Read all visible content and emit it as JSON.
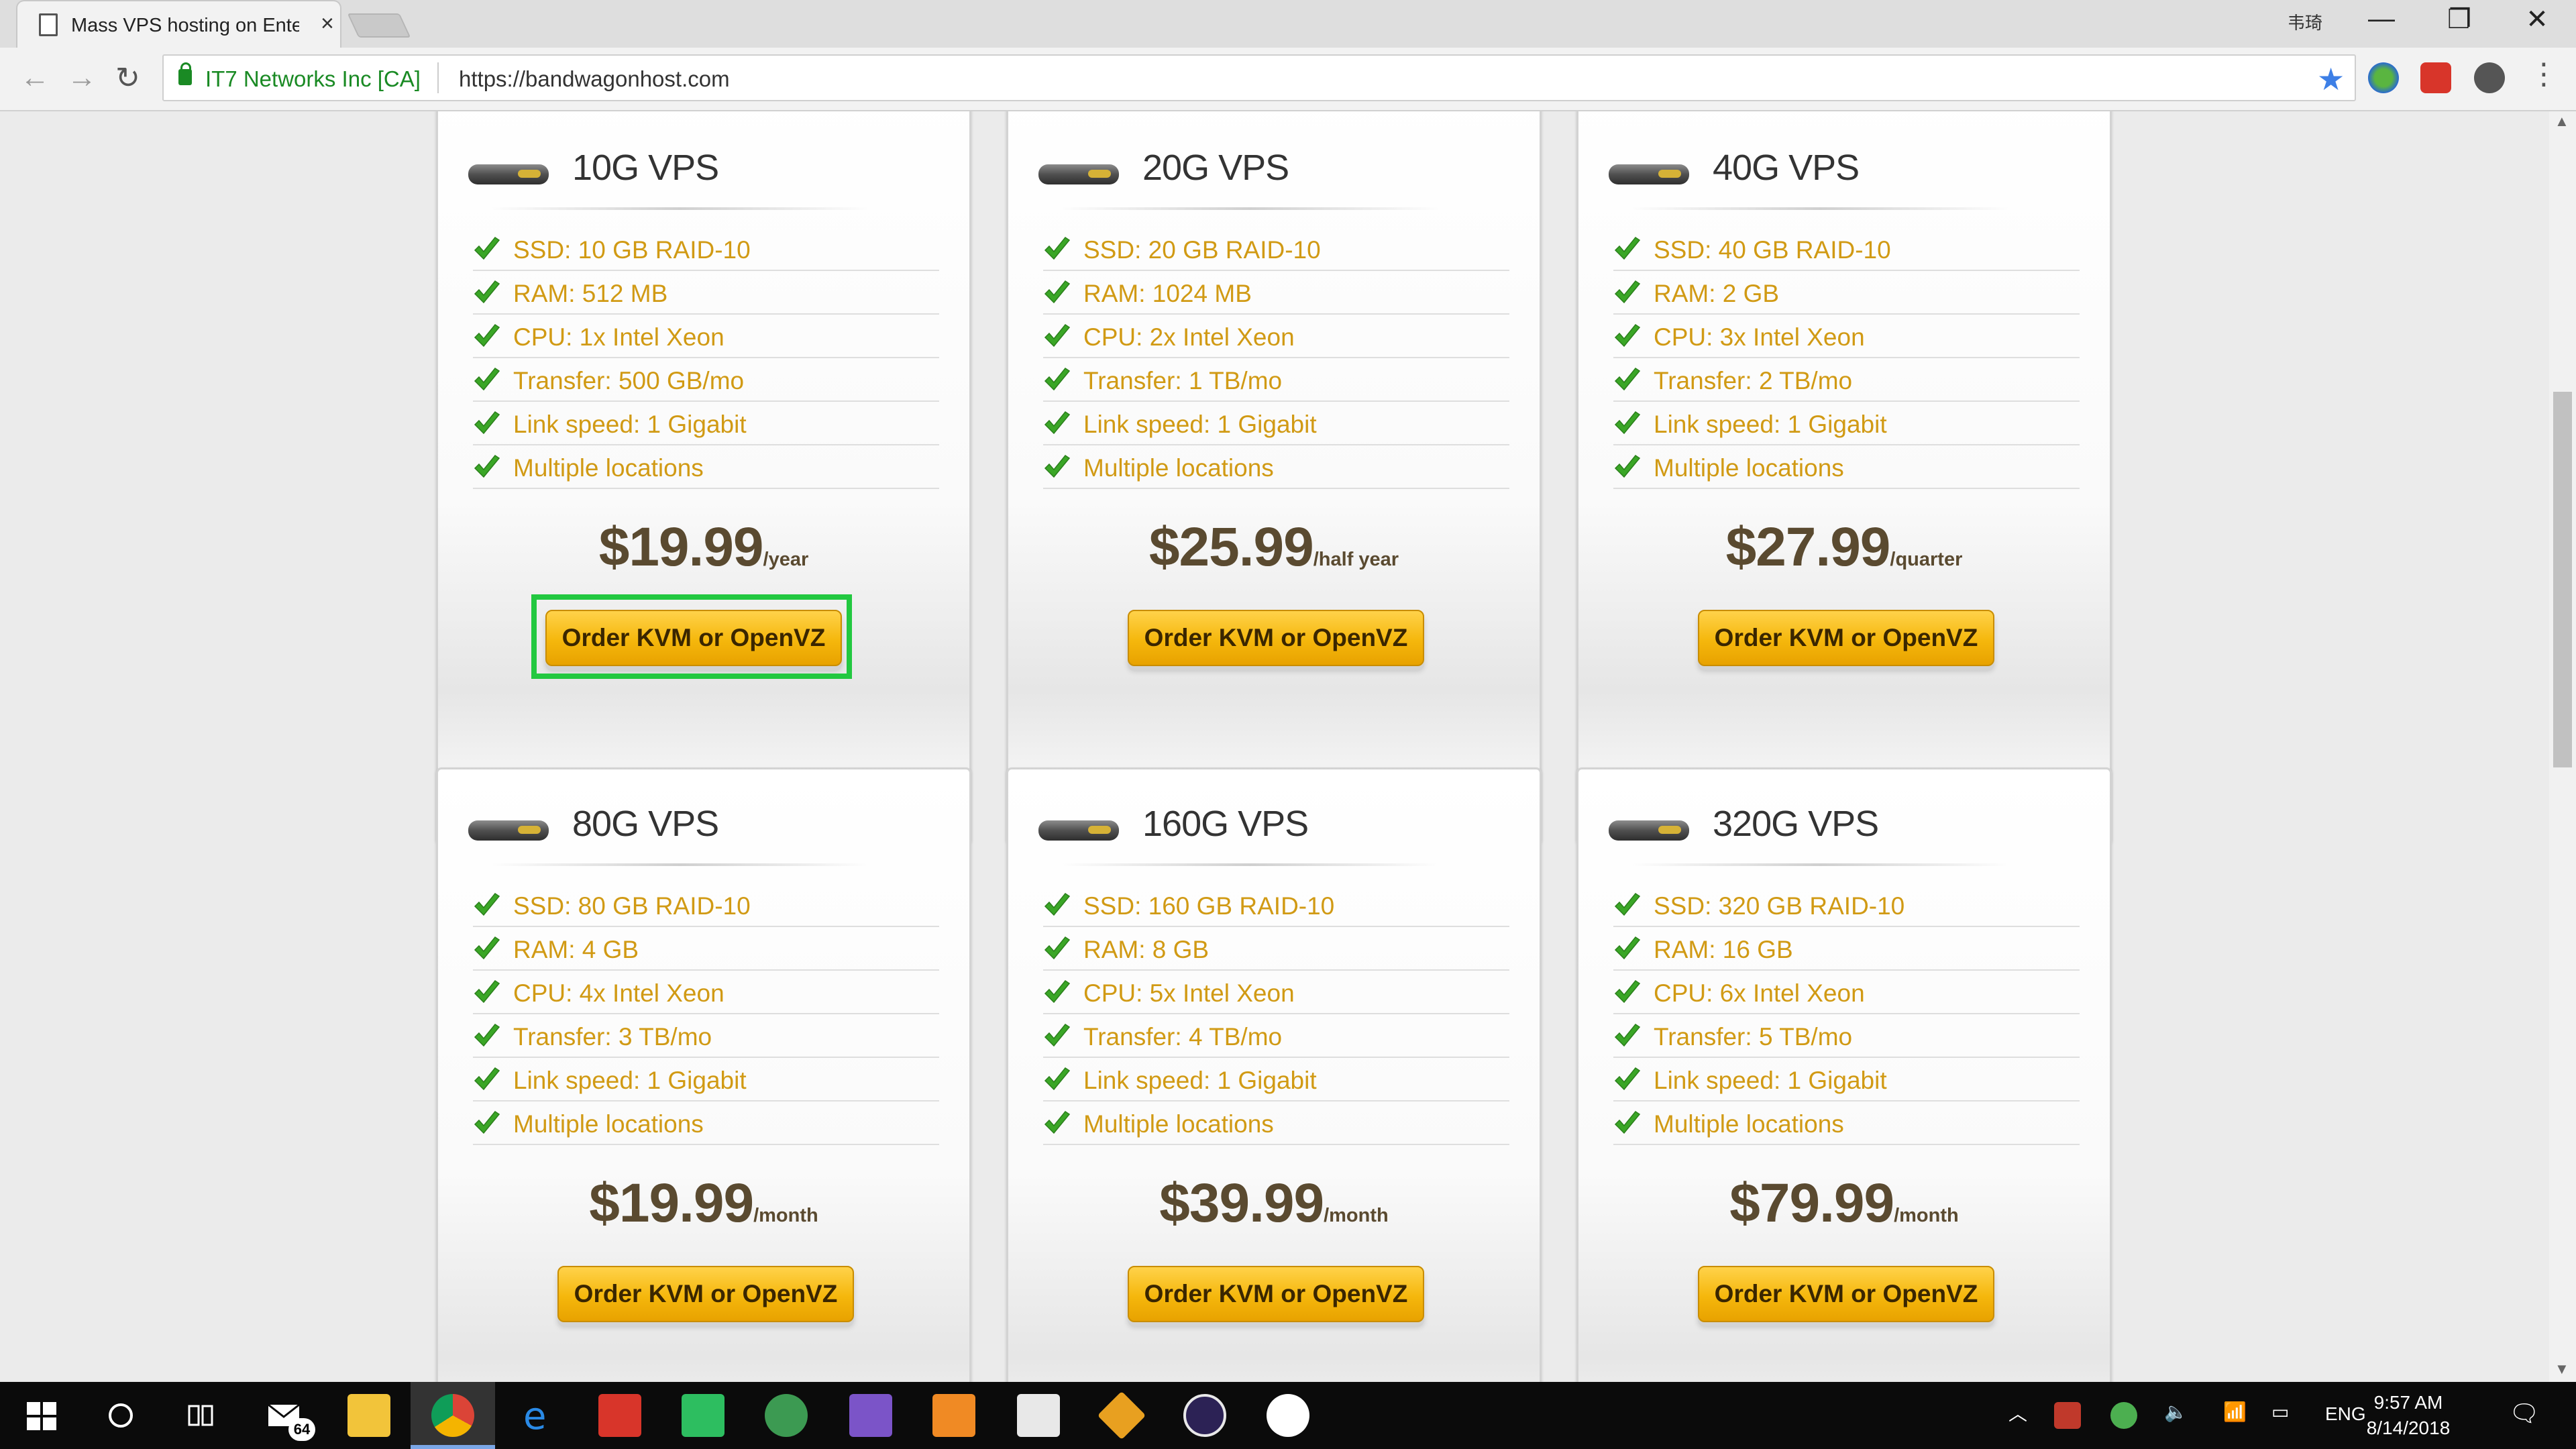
{
  "browser": {
    "tab_title": "Mass VPS hosting on Ente",
    "tab_close": "×",
    "user_label": "韦琦",
    "cert_name": "IT7 Networks Inc [CA]",
    "url": "https://bandwagonhost.com",
    "star": "★",
    "back": "←",
    "forward": "→",
    "reload": "↻",
    "minimize": "—",
    "restore": "❐",
    "close": "✕",
    "menu": "⋮"
  },
  "plans": [
    {
      "title": "10G VPS",
      "features": [
        "SSD: 10 GB RAID-10",
        "RAM: 512 MB",
        "CPU: 1x Intel Xeon",
        "Transfer: 500 GB/mo",
        "Link speed: 1 Gigabit",
        "Multiple locations"
      ],
      "price": "$19.99",
      "period": "/year",
      "button": "Order KVM or OpenVZ"
    },
    {
      "title": "20G VPS",
      "features": [
        "SSD: 20 GB RAID-10",
        "RAM: 1024 MB",
        "CPU: 2x Intel Xeon",
        "Transfer: 1 TB/mo",
        "Link speed: 1 Gigabit",
        "Multiple locations"
      ],
      "price": "$25.99",
      "period": "/half year",
      "button": "Order KVM or OpenVZ"
    },
    {
      "title": "40G VPS",
      "features": [
        "SSD: 40 GB RAID-10",
        "RAM: 2 GB",
        "CPU: 3x Intel Xeon",
        "Transfer: 2 TB/mo",
        "Link speed: 1 Gigabit",
        "Multiple locations"
      ],
      "price": "$27.99",
      "period": "/quarter",
      "button": "Order KVM or OpenVZ"
    },
    {
      "title": "80G VPS",
      "features": [
        "SSD: 80 GB RAID-10",
        "RAM: 4 GB",
        "CPU: 4x Intel Xeon",
        "Transfer: 3 TB/mo",
        "Link speed: 1 Gigabit",
        "Multiple locations"
      ],
      "price": "$19.99",
      "period": "/month",
      "button": "Order KVM or OpenVZ"
    },
    {
      "title": "160G VPS",
      "features": [
        "SSD: 160 GB RAID-10",
        "RAM: 8 GB",
        "CPU: 5x Intel Xeon",
        "Transfer: 4 TB/mo",
        "Link speed: 1 Gigabit",
        "Multiple locations"
      ],
      "price": "$39.99",
      "period": "/month",
      "button": "Order KVM or OpenVZ"
    },
    {
      "title": "320G VPS",
      "features": [
        "SSD: 320 GB RAID-10",
        "RAM: 16 GB",
        "CPU: 6x Intel Xeon",
        "Transfer: 5 TB/mo",
        "Link speed: 1 Gigabit",
        "Multiple locations"
      ],
      "price": "$79.99",
      "period": "/month",
      "button": "Order KVM or OpenVZ"
    }
  ],
  "colors": {
    "feature_text": "#d19a14",
    "price_text": "#5a4a30",
    "button": "#f5b70c",
    "highlight": "#22c840",
    "check": "#3aa626"
  },
  "taskbar": {
    "mail_badge": "64",
    "language": "ENG",
    "time": "9:57 AM",
    "date": "8/14/2018"
  }
}
